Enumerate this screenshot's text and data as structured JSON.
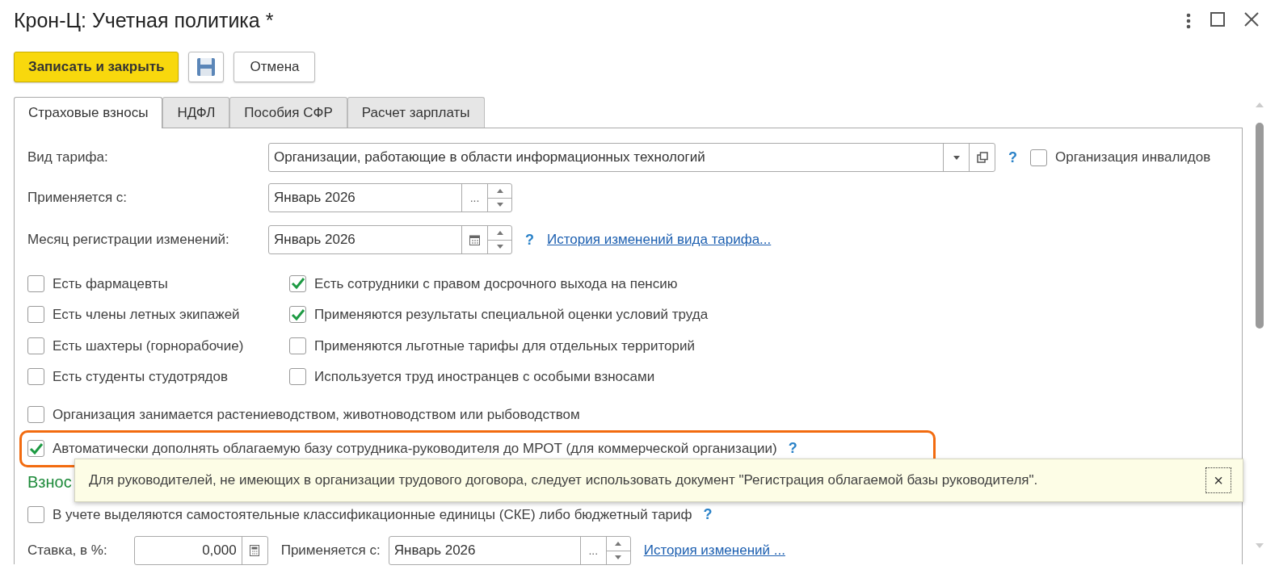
{
  "window": {
    "title": "Крон-Ц: Учетная политика *"
  },
  "toolbar": {
    "save_close": "Записать и закрыть",
    "cancel": "Отмена"
  },
  "tabs": [
    {
      "label": "Страховые взносы",
      "selected": true
    },
    {
      "label": "НДФЛ",
      "selected": false
    },
    {
      "label": "Пособия СФР",
      "selected": false
    },
    {
      "label": "Расчет зарплаты",
      "selected": false
    }
  ],
  "tariff": {
    "label": "Вид тарифа:",
    "value": "Организации, работающие в области информационных технологий",
    "help": "?",
    "disabled_org": {
      "label": "Организация инвалидов",
      "checked": false
    }
  },
  "applies_from": {
    "label": "Применяется с:",
    "value": "Январь 2026",
    "choose": "..."
  },
  "registration_month": {
    "label": "Месяц регистрации изменений:",
    "value": "Январь 2026",
    "help": "?",
    "history_link": "История изменений вида тарифа..."
  },
  "options_left": [
    {
      "label": "Есть фармацевты",
      "checked": false
    },
    {
      "label": "Есть члены летных экипажей",
      "checked": false
    },
    {
      "label": "Есть шахтеры (горнорабочие)",
      "checked": false
    },
    {
      "label": "Есть студенты студотрядов",
      "checked": false
    }
  ],
  "options_right": [
    {
      "label": "Есть сотрудники с правом досрочного выхода на пенсию",
      "checked": true
    },
    {
      "label": "Применяются результаты специальной оценки условий труда",
      "checked": true
    },
    {
      "label": "Применяются льготные тарифы для отдельных территорий",
      "checked": false
    },
    {
      "label": "Используется труд иностранцев с особыми взносами",
      "checked": false
    }
  ],
  "options_wide": [
    {
      "label": "Организация занимается растениеводством, животноводством или рыбоводством",
      "checked": false,
      "highlighted": false
    },
    {
      "label": "Автоматически дополнять облагаемую базу сотрудника-руководителя до МРОТ (для коммерческой организации)",
      "checked": true,
      "highlighted": true,
      "help": "?"
    }
  ],
  "section_heading": "Взнос",
  "ske_option": {
    "label": "В учете выделяются самостоятельные классификационные единицы (СКЕ) либо бюджетный тариф",
    "checked": false,
    "help": "?"
  },
  "rate": {
    "label": "Ставка, в %:",
    "value": "0,000",
    "applies_label": "Применяется с:",
    "applies_value": "Январь 2026",
    "choose": "...",
    "history_link": "История изменений ..."
  },
  "tooltip": {
    "text": "Для руководителей, не имеющих в организации трудового договора, следует использовать документ \"Регистрация облагаемой базы руководителя\".",
    "close": "×"
  }
}
